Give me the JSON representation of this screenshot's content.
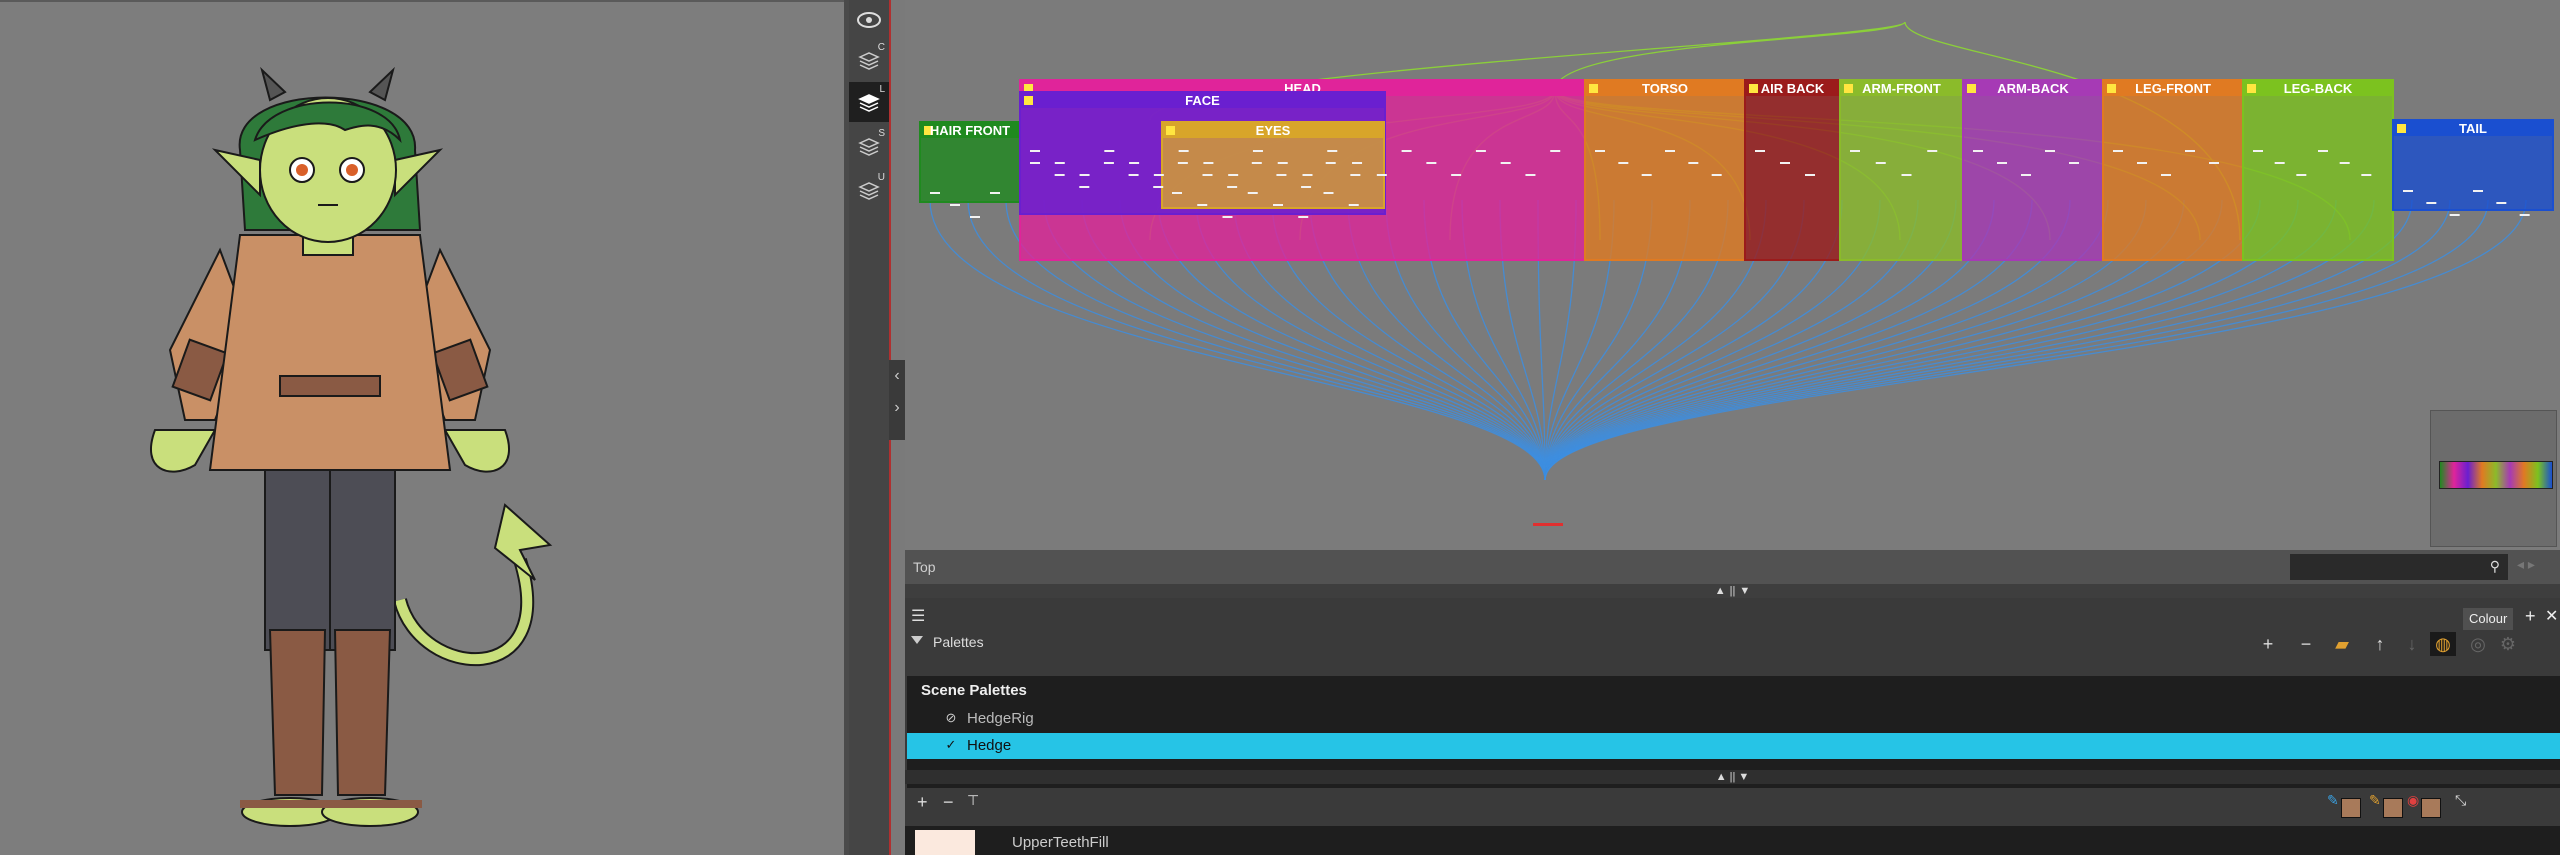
{
  "layers": [
    "C",
    "L",
    "S",
    "U"
  ],
  "nodeview": {
    "groups": [
      {
        "label": "HAIR FRONT",
        "color": "#1f8a1f"
      },
      {
        "label": "HEAD",
        "color": "#e0249a"
      },
      {
        "label": "FACE",
        "color": "#6a1fd0"
      },
      {
        "label": "EYES",
        "color": "#d8a52a"
      },
      {
        "label": "TORSO",
        "color": "#e07a22"
      },
      {
        "label": "AIR BACK",
        "color": "#9b1b1b"
      },
      {
        "label": "ARM-FRONT",
        "color": "#8bbb2a"
      },
      {
        "label": "ARM-BACK",
        "color": "#a63ab5"
      },
      {
        "label": "LEG-FRONT",
        "color": "#e07a22"
      },
      {
        "label": "LEG-BACK",
        "color": "#7cc21f"
      },
      {
        "label": "TAIL",
        "color": "#1a4fd0"
      }
    ]
  },
  "navbar": {
    "crumb": "Top"
  },
  "panel": {
    "tab_label": "Colour",
    "palettes_label": "Palettes",
    "scene_palettes_label": "Scene Palettes",
    "palettes": [
      {
        "name": "HedgeRig",
        "selected": false
      },
      {
        "name": "Hedge",
        "selected": true
      }
    ],
    "colours": [
      {
        "name": "UpperTeethFill",
        "swatch": "#fbe9de"
      }
    ]
  }
}
